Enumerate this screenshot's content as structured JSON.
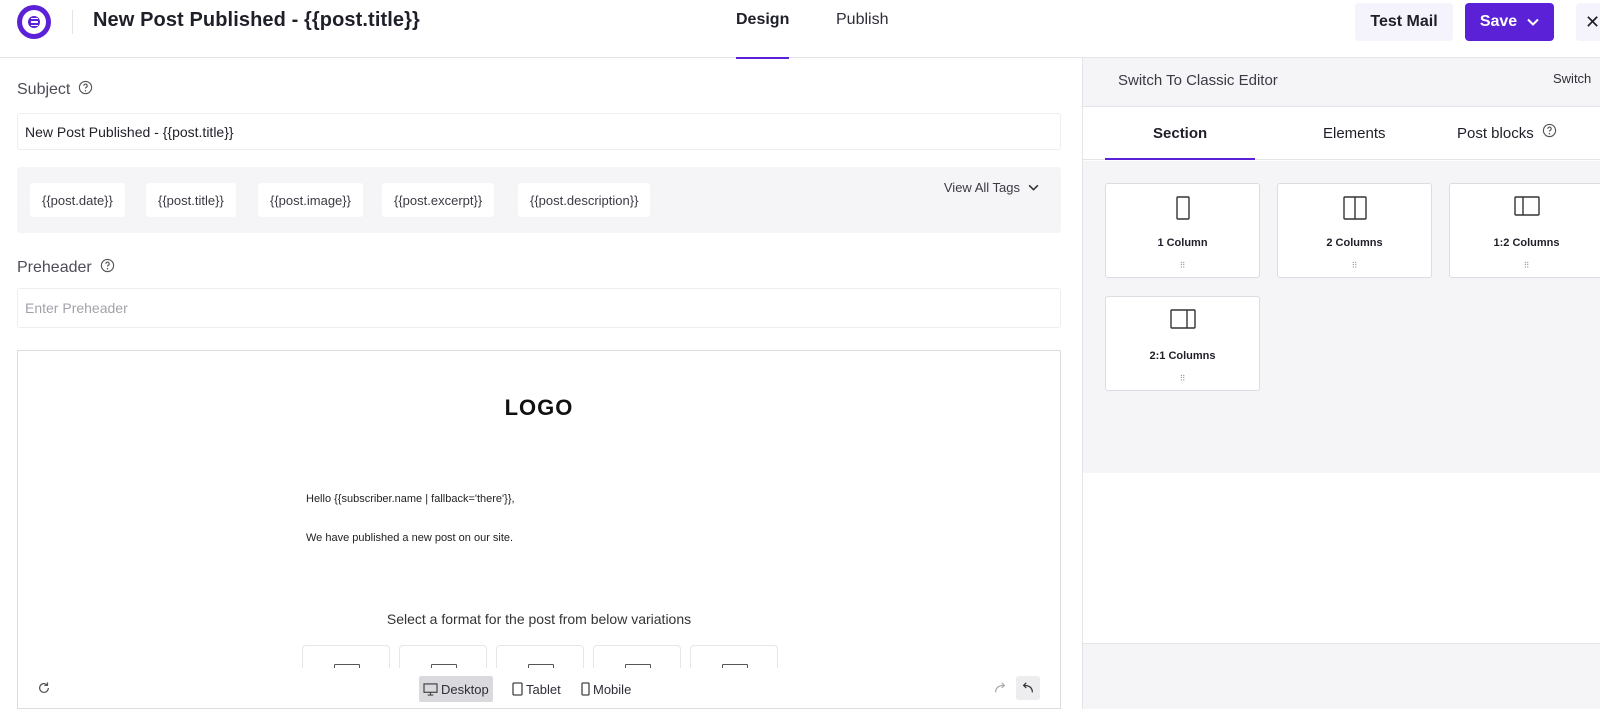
{
  "header": {
    "title": "New Post Published - {{post.title}}",
    "tabs": [
      {
        "label": "Design",
        "active": true
      },
      {
        "label": "Publish",
        "active": false
      }
    ],
    "test_mail_label": "Test Mail",
    "save_label": "Save"
  },
  "subject": {
    "label": "Subject",
    "value": "New Post Published - {{post.title}}"
  },
  "tags": {
    "items": [
      "{{post.date}}",
      "{{post.title}}",
      "{{post.image}}",
      "{{post.excerpt}}",
      "{{post.description}}"
    ],
    "view_all_label": "View All Tags"
  },
  "preheader": {
    "label": "Preheader",
    "placeholder": "Enter Preheader"
  },
  "canvas": {
    "logo_text": "LOGO",
    "greeting": "Hello {{subscriber.name | fallback='there'}},",
    "body": "We have published a new post on our site.",
    "select_prompt": "Select a format for the post from below variations",
    "devices": [
      {
        "label": "Desktop",
        "active": true
      },
      {
        "label": "Tablet",
        "active": false
      },
      {
        "label": "Mobile",
        "active": false
      }
    ]
  },
  "sidebar": {
    "switch_title": "Switch To Classic Editor",
    "switch_button": "Switch",
    "tabs": [
      {
        "label": "Section",
        "active": true
      },
      {
        "label": "Elements",
        "active": false
      },
      {
        "label": "Post blocks",
        "active": false
      }
    ],
    "blocks": [
      {
        "label": "1 Column",
        "icon": "one-column-icon"
      },
      {
        "label": "2 Columns",
        "icon": "two-columns-icon"
      },
      {
        "label": "1:2 Columns",
        "icon": "one-two-columns-icon"
      },
      {
        "label": "2:1 Columns",
        "icon": "two-one-columns-icon"
      }
    ]
  },
  "colors": {
    "accent": "#5b21d6",
    "panel_bg": "#f5f5f7",
    "border": "#e3e3e8"
  }
}
